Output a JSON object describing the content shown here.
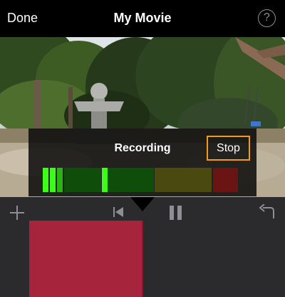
{
  "header": {
    "done_label": "Done",
    "title": "My Movie",
    "help_label": "?"
  },
  "recording": {
    "label": "Recording",
    "stop_label": "Stop",
    "accent_color": "#f39c12",
    "meter_level": 0.32,
    "meter_peak": 0.32
  },
  "toolbar": {
    "add_icon": "plus-icon",
    "rewind_icon": "skip-to-start-icon",
    "pause_icon": "pause-icon",
    "undo_icon": "undo-icon"
  },
  "clip": {
    "color": "#a7243d"
  }
}
